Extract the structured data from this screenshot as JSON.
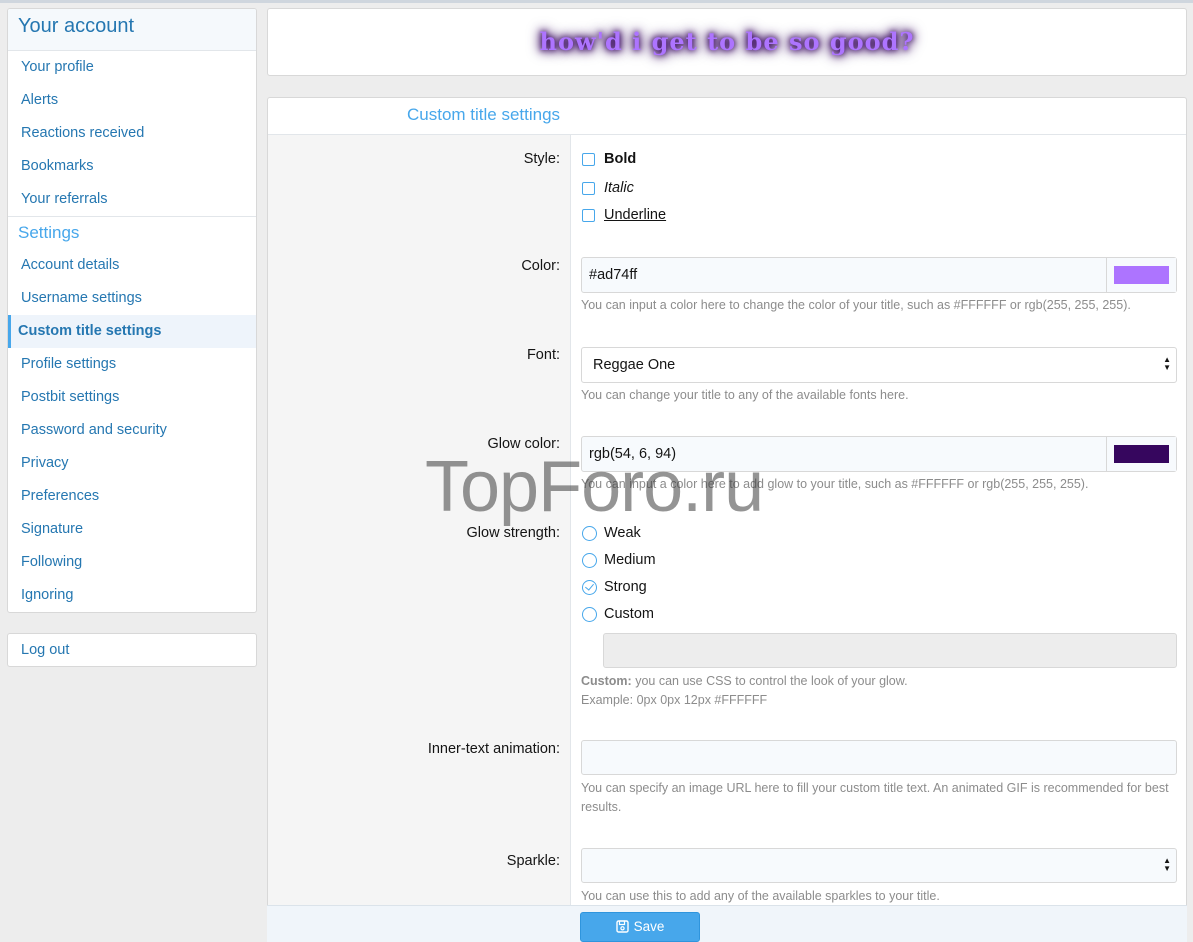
{
  "sidebar": {
    "account_heading": "Your account",
    "account_items": [
      "Your profile",
      "Alerts",
      "Reactions received",
      "Bookmarks",
      "Your referrals"
    ],
    "settings_heading": "Settings",
    "settings_items": [
      "Account details",
      "Username settings",
      "Custom title settings",
      "Profile settings",
      "Postbit settings",
      "Password and security",
      "Privacy",
      "Preferences",
      "Signature",
      "Following",
      "Ignoring"
    ],
    "active_item": "Custom title settings",
    "logout": "Log out"
  },
  "preview": {
    "title_text": "how'd i get to be so good?",
    "color": "#ad74ff",
    "glow": "rgb(54, 6, 94)"
  },
  "form": {
    "heading": "Custom title settings",
    "style_label": "Style:",
    "style_options": [
      {
        "label": "Bold",
        "checked": false
      },
      {
        "label": "Italic",
        "checked": false
      },
      {
        "label": "Underline",
        "checked": false
      }
    ],
    "color_label": "Color:",
    "color_value": "#ad74ff",
    "color_swatch": "#ad74ff",
    "color_hint": "You can input a color here to change the color of your title, such as #FFFFFF or rgb(255, 255, 255).",
    "font_label": "Font:",
    "font_value": "Reggae One",
    "font_hint": "You can change your title to any of the available fonts here.",
    "glow_color_label": "Glow color:",
    "glow_color_value": "rgb(54, 6, 94)",
    "glow_swatch": "#36065e",
    "glow_color_hint": "You can input a color here to add glow to your title, such as #FFFFFF or rgb(255, 255, 255).",
    "glow_strength_label": "Glow strength:",
    "glow_strength_options": [
      "Weak",
      "Medium",
      "Strong",
      "Custom"
    ],
    "glow_strength_selected": "Strong",
    "custom_hint_bold": "Custom:",
    "custom_hint_text": "you can use CSS to control the look of your glow.",
    "custom_hint_example": "Example: 0px 0px 12px #FFFFFF",
    "animation_label": "Inner-text animation:",
    "animation_value": "",
    "animation_hint": "You can specify an image URL here to fill your custom title text. An animated GIF is recommended for best results.",
    "sparkle_label": "Sparkle:",
    "sparkle_value": "",
    "sparkle_hint": "You can use this to add any of the available sparkles to your title.",
    "save_label": "Save"
  },
  "watermark": "TopForo.ru"
}
